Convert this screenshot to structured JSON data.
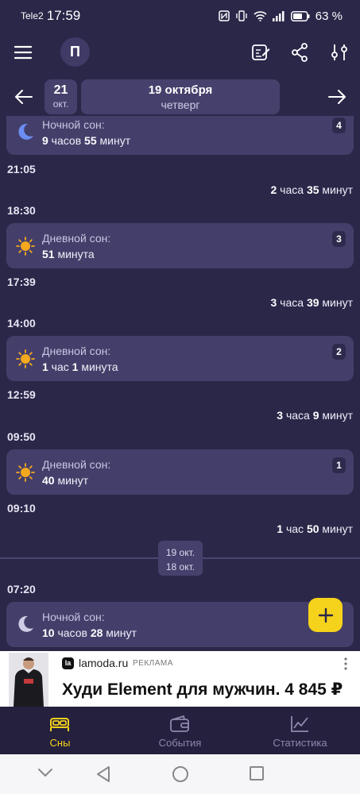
{
  "status": {
    "carrier": "Tele2",
    "time": "17:59",
    "battery": "63 %"
  },
  "header": {
    "menu_icon": "hamburger-icon",
    "avatar_letter": "П",
    "actions": [
      "edit-notes-icon",
      "share-icon",
      "sliders-icon"
    ]
  },
  "date_nav": {
    "prev_icon": "arrow-left-icon",
    "next_icon": "arrow-right-icon",
    "prev_day": "21",
    "prev_month": "окт.",
    "current_date": "19 октября",
    "current_weekday": "четверг"
  },
  "feed": {
    "cards": [
      {
        "type": "night",
        "icon": "moon-icon",
        "label": "Ночной сон:",
        "d1": "9",
        "u1": " часов ",
        "d2": "55",
        "u2": " минут",
        "badge": "4"
      },
      {
        "type": "day",
        "icon": "sun-icon",
        "label": "Дневной сон:",
        "d1": "51",
        "u1": " минута",
        "badge": "3"
      },
      {
        "type": "day",
        "icon": "sun-icon",
        "label": "Дневной сон:",
        "d1": "1",
        "u1": " час ",
        "d2": "1",
        "u2": " минута",
        "badge": "2"
      },
      {
        "type": "day",
        "icon": "sun-icon",
        "label": "Дневной сон:",
        "d1": "40",
        "u1": " минут",
        "badge": "1"
      },
      {
        "type": "night",
        "icon": "moon-icon",
        "label": "Ночной сон:",
        "d1": "10",
        "u1": " часов ",
        "d2": "28",
        "u2": " минут"
      }
    ],
    "times": [
      "21:05",
      "18:30",
      "17:39",
      "14:00",
      "12:59",
      "09:50",
      "09:10",
      "07:20"
    ],
    "gaps": [
      {
        "a": "2",
        "au": " часа ",
        "b": "35",
        "bu": " минут"
      },
      {
        "a": "3",
        "au": " часа ",
        "b": "39",
        "bu": " минут"
      },
      {
        "a": "3",
        "au": " часа ",
        "b": "9",
        "bu": " минут"
      },
      {
        "a": "1",
        "au": " час ",
        "b": "50",
        "bu": " минут"
      }
    ],
    "divider": {
      "top": "19 окт.",
      "bottom": "18 окт."
    }
  },
  "fab": {
    "icon": "plus-icon"
  },
  "ad": {
    "brand_logo": "la",
    "brand": "lamoda.ru",
    "tag": "РЕКЛАМА",
    "headline": "Худи Element для мужчин. 4 845 ₽",
    "more_icon": "more-vertical-icon"
  },
  "bottom_nav": [
    {
      "label": "Сны",
      "icon": "bed-icon",
      "active": true
    },
    {
      "label": "События",
      "icon": "wallet-icon",
      "active": false
    },
    {
      "label": "Статистика",
      "icon": "chart-icon",
      "active": false
    }
  ],
  "colors": {
    "background": "#2b2749",
    "card": "#443f6a",
    "accent": "#f5d21b",
    "sun": "#f6a81e"
  }
}
